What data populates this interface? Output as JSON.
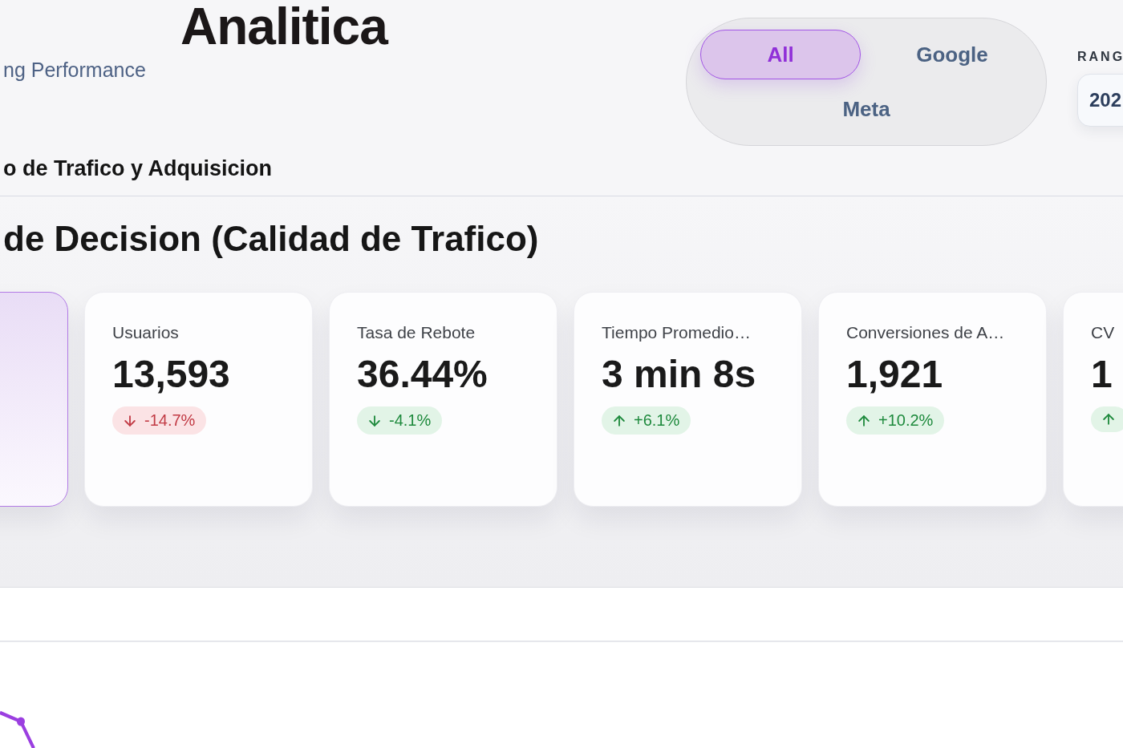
{
  "header": {
    "title": "Analitica",
    "subtitle": "ng Performance"
  },
  "source_filter": {
    "options": [
      {
        "label": "All",
        "selected": true
      },
      {
        "label": "Google",
        "selected": false
      },
      {
        "label": "Meta",
        "selected": false
      }
    ]
  },
  "range": {
    "label": "RANG",
    "value": "202"
  },
  "section": {
    "title": "o de Trafico y Adquisicion"
  },
  "kpi_panel": {
    "heading": "de Decision (Calidad de Trafico)",
    "cards": [
      {
        "highlighted": true
      },
      {
        "highlighted": false,
        "label": "Usuarios",
        "value": "13,593",
        "delta": {
          "text": "-14.7%",
          "rising": false,
          "favorable": false
        }
      },
      {
        "highlighted": false,
        "label": "Tasa de Rebote",
        "value": "36.44%",
        "delta": {
          "text": "-4.1%",
          "rising": false,
          "favorable": true
        }
      },
      {
        "highlighted": false,
        "label": "Tiempo Promedio…",
        "value": "3 min 8s",
        "delta": {
          "text": "+6.1%",
          "rising": true,
          "favorable": true
        }
      },
      {
        "highlighted": false,
        "label": "Conversiones de A…",
        "value": "1,921",
        "delta": {
          "text": "+10.2%",
          "rising": true,
          "favorable": true
        }
      },
      {
        "highlighted": false,
        "label": "CV",
        "value": "1",
        "delta": {
          "rising": true,
          "favorable": true
        }
      }
    ]
  }
}
